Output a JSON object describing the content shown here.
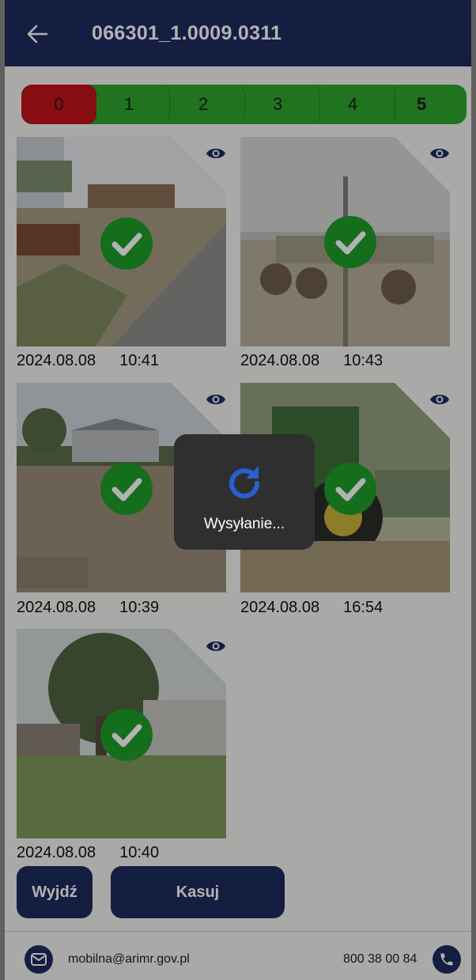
{
  "header": {
    "title": "066301_1.0009.0311",
    "back_icon": "arrow-left-icon"
  },
  "rating": {
    "segments": [
      "0",
      "1",
      "2",
      "3",
      "4",
      "5"
    ],
    "selected": "0",
    "selected_color": "#c2141b",
    "default_color": "#2ea62e"
  },
  "photos": [
    {
      "date": "2024.08.08",
      "time": "10:41",
      "status": "check-icon",
      "view_icon": "eye-icon"
    },
    {
      "date": "2024.08.08",
      "time": "10:43",
      "status": "check-icon",
      "view_icon": "eye-icon"
    },
    {
      "date": "2024.08.08",
      "time": "10:39",
      "status": "check-icon",
      "view_icon": "eye-icon"
    },
    {
      "date": "2024.08.08",
      "time": "16:54",
      "status": "check-icon",
      "view_icon": "eye-icon"
    },
    {
      "date": "2024.08.08",
      "time": "10:40",
      "status": "check-icon",
      "view_icon": "eye-icon"
    }
  ],
  "buttons": {
    "exit_label": "Wyjdź",
    "delete_label": "Kasuj"
  },
  "footer": {
    "email": "mobilna@arimr.gov.pl",
    "phone": "800 38 00 84",
    "email_icon": "mail-icon",
    "phone_icon": "phone-icon"
  },
  "loading": {
    "text": "Wysyłanie...",
    "icon": "refresh-icon"
  },
  "colors": {
    "primary": "#1c2b5e",
    "check": "#1f9e27",
    "accent_spinner": "#2a5fd1"
  }
}
